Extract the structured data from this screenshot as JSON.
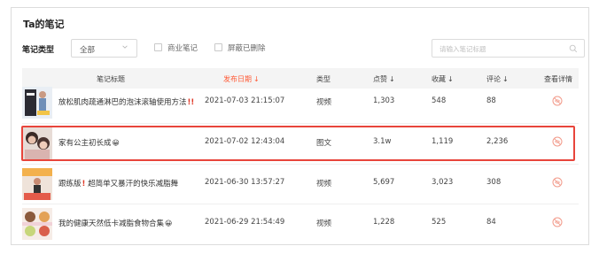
{
  "panel": {
    "title": "Ta的笔记"
  },
  "filters": {
    "type_label": "笔记类型",
    "type_value": "全部",
    "commercial_label": "商业笔记",
    "blocked_label": "屏蔽已删除",
    "search_placeholder": "请输入笔记标题"
  },
  "table": {
    "headers": {
      "title": "笔记标题",
      "publish_date": "发布日期",
      "type": "类型",
      "likes": "点赞",
      "favorites": "收藏",
      "comments": "评论",
      "detail": "查看详情"
    },
    "sort_arrow": "↓",
    "rows": [
      {
        "title": "放松肌肉疏通淋巴的泡沫滚轴使用方法",
        "title_mark": "!!",
        "title_emoji": "",
        "date": "2021-07-03 21:15:07",
        "type": "视频",
        "likes": "1,303",
        "favorites": "548",
        "comments": "88"
      },
      {
        "title": "家有公主初长成",
        "title_mark": "",
        "title_emoji": "😀",
        "date": "2021-07-02 12:43:04",
        "type": "图文",
        "likes": "3.1w",
        "favorites": "1,119",
        "comments": "2,236"
      },
      {
        "title": "跟练版",
        "title_mark": "!",
        "title_rest": " 超简单又暴汗的快乐减脂舞",
        "title_emoji": "",
        "date": "2021-06-30 13:57:27",
        "type": "视频",
        "likes": "5,697",
        "favorites": "3,023",
        "comments": "308"
      },
      {
        "title": "我的健康天然低卡减脂食物合集",
        "title_mark": "",
        "title_emoji": "😀",
        "date": "2021-06-29 21:54:49",
        "type": "视频",
        "likes": "1,228",
        "favorites": "525",
        "comments": "84"
      }
    ]
  },
  "colors": {
    "accent": "#ff5a36",
    "highlight_border": "#e8453b",
    "header_bg": "#f4f4f4",
    "detail_icon": "#f29a8a"
  },
  "icons": {
    "select": "chevron-down-icon",
    "search": "search-icon",
    "detail": "eye-off-icon"
  }
}
